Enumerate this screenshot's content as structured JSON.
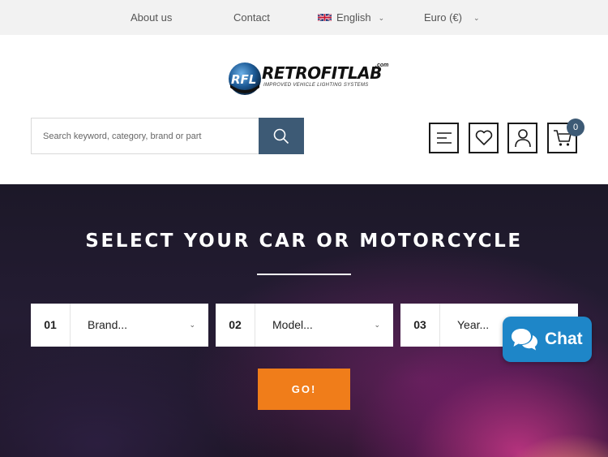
{
  "topbar": {
    "about": "About us",
    "contact": "Contact",
    "language": "English",
    "currency": "Euro (€)"
  },
  "logo": {
    "name": "RETROFITLAB",
    "tld": ".com",
    "tagline": "IMPROVED VEHICLE LIGHTING SYSTEMS"
  },
  "search": {
    "placeholder": "Search keyword, category, brand or part"
  },
  "header_icons": {
    "cart_count": "0"
  },
  "hero": {
    "title": "SELECT YOUR CAR OR MOTORCYCLE",
    "selects": [
      {
        "num": "01",
        "label": "Brand..."
      },
      {
        "num": "02",
        "label": "Model..."
      },
      {
        "num": "03",
        "label": "Year..."
      }
    ],
    "go_label": "GO!"
  },
  "chat": {
    "label": "Chat"
  },
  "colors": {
    "accent_blue": "#3d5a75",
    "go_orange": "#f07d1a",
    "chat_blue": "#1e86c8"
  }
}
